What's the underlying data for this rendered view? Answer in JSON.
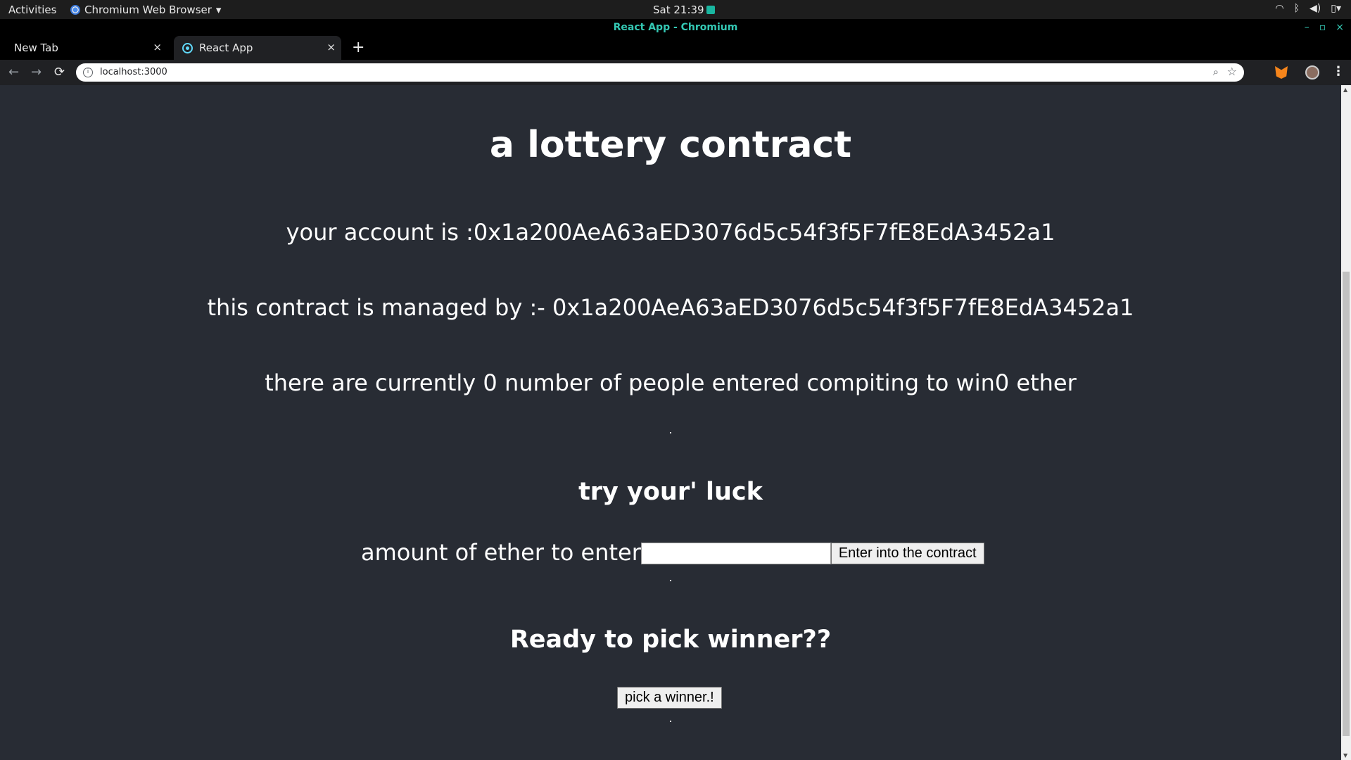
{
  "system_bar": {
    "activities": "Activities",
    "app_name": "Chromium Web Browser",
    "app_caret": "▾",
    "clock": "Sat 21:39"
  },
  "window": {
    "title": "React App - Chromium"
  },
  "tabs": [
    {
      "label": "New Tab",
      "close": "×"
    },
    {
      "label": "React App",
      "close": "×"
    }
  ],
  "new_tab_button": "+",
  "toolbar": {
    "back": "←",
    "forward": "→",
    "reload": "⟳",
    "url": "localhost:3000",
    "info": "i",
    "zoom": "⌕",
    "star": "☆",
    "menu": "⋮"
  },
  "page": {
    "title": "a lottery contract",
    "account_line": "your account is :0x1a200AeA63aED3076d5c54f3f5F7fE8EdA3452a1",
    "manager_line": "this contract is managed by :- 0x1a200AeA63aED3076d5c54f3f5F7fE8EdA3452a1",
    "players_line": "there are currently 0 number of people entered compiting to win0 ether",
    "dot": ".",
    "try_heading": "try your' luck",
    "amount_label": "amount of ether to enter",
    "amount_value": "",
    "enter_button": "Enter into the contract",
    "winner_heading": "Ready to pick winner??",
    "winner_button": "pick a winner.!"
  }
}
